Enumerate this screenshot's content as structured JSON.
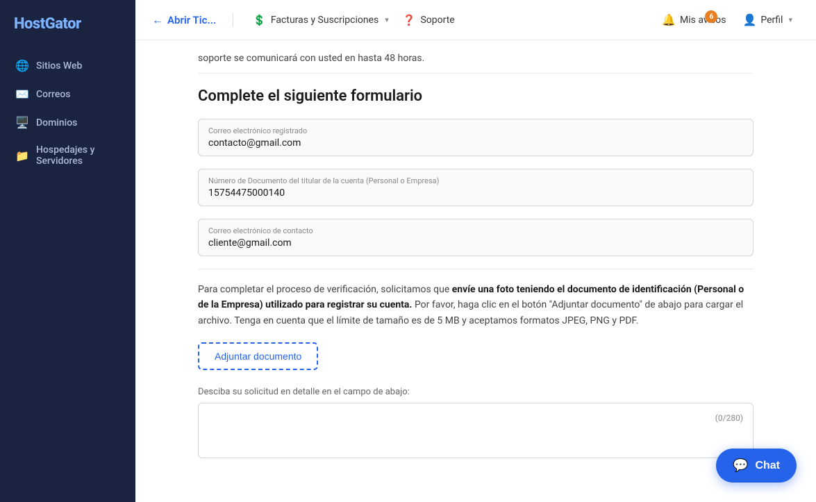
{
  "logo": {
    "part1": "Host",
    "part2": "Gator"
  },
  "sidebar": {
    "items": [
      {
        "id": "sitios-web",
        "label": "Sitios Web",
        "icon": "🌐"
      },
      {
        "id": "correos",
        "label": "Correos",
        "icon": "✉️"
      },
      {
        "id": "dominios",
        "label": "Dominios",
        "icon": "🖥️"
      },
      {
        "id": "hospedajes",
        "label": "Hospedajes y Servidores",
        "icon": "📁"
      }
    ]
  },
  "topnav": {
    "back_label": "Abrir Tic...",
    "facturas_label": "Facturas y Suscripciones",
    "soporte_label": "Soporte",
    "avisos_label": "Mis avisos",
    "avisos_badge": "6",
    "perfil_label": "Perfil"
  },
  "page": {
    "top_note": "soporte se comunicará con usted en hasta 48 horas.",
    "top_note_link1": "comunicará",
    "top_note_link2": "en",
    "top_note_link3": "hasta",
    "top_note_link4": "48 horas",
    "section_title": "Complete el siguiente formulario",
    "email_label": "Correo electrónico registrado",
    "email_value": "contacto@gmail.com",
    "document_label": "Número de Documento del titular de la cuenta (Personal o Empresa)",
    "document_value": "15754475000140",
    "contact_email_label": "Correo electrónico de contacto",
    "contact_email_value": "cliente@gmail.com",
    "verification_bold": "envíe una foto teniendo el documento de identificación (Personal o de la Empresa) utilizado para registrar su cuenta.",
    "verification_intro": "Para completar el proceso de verificación, solicitamos que ",
    "verification_rest": " Por favor, haga clic en el botón \"Adjuntar documento\" de abajo para cargar el archivo. Tenga en cuenta que el límite de tamaño es de 5 MB y aceptamos formatos JPEG, PNG y PDF.",
    "attach_label": "Adjuntar documento",
    "description_placeholder": "Desciba su solicitud en detalle en el campo de abajo:",
    "char_counter": "(0/280)",
    "chat_label": "Chat"
  }
}
